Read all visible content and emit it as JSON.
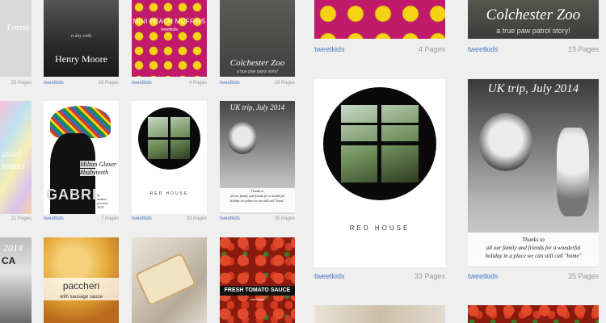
{
  "publisher": "tweetkids",
  "books": {
    "forest": {
      "title": "Forest",
      "pages": "25 Pages"
    },
    "henry_moore": {
      "subtitle": "a day with",
      "title": "Henry Moore",
      "pages": "26 Pages"
    },
    "peach_muffins": {
      "title": "MINI PEACH MUFFINS",
      "author": "tweetkids",
      "pages": "4 Pages"
    },
    "colchester_zoo": {
      "title": "Colchester Zoo",
      "subtitle": "a true paw patrol story!",
      "pages": "19 Pages"
    },
    "pastel_dreams": {
      "title": "astel\nreams",
      "pages": "21 Pages"
    },
    "milton_glaser": {
      "title": "Milton Glaser",
      "hashtag": "#babyteeth",
      "letters": "GABRI",
      "credit": "by\nstudent\nportraits\n2014",
      "pages": "7 Pages"
    },
    "red_house": {
      "title": "RED HOUSE",
      "pages": "33 Pages"
    },
    "uk_trip": {
      "title": "UK trip, July 2014",
      "caption": "Thanks to\nall our family and friends for a wonderful\nholiday in a place we can still call \"home\"",
      "pages": "35 Pages"
    },
    "ca_2014": {
      "year": "2014",
      "letters": "CA"
    },
    "paccheri": {
      "title": "paccheri",
      "subtitle": "with sausage sauce"
    },
    "tomato_sauce": {
      "title": "FRESH TOMATO SAUCE",
      "author": "tweetkids"
    }
  }
}
